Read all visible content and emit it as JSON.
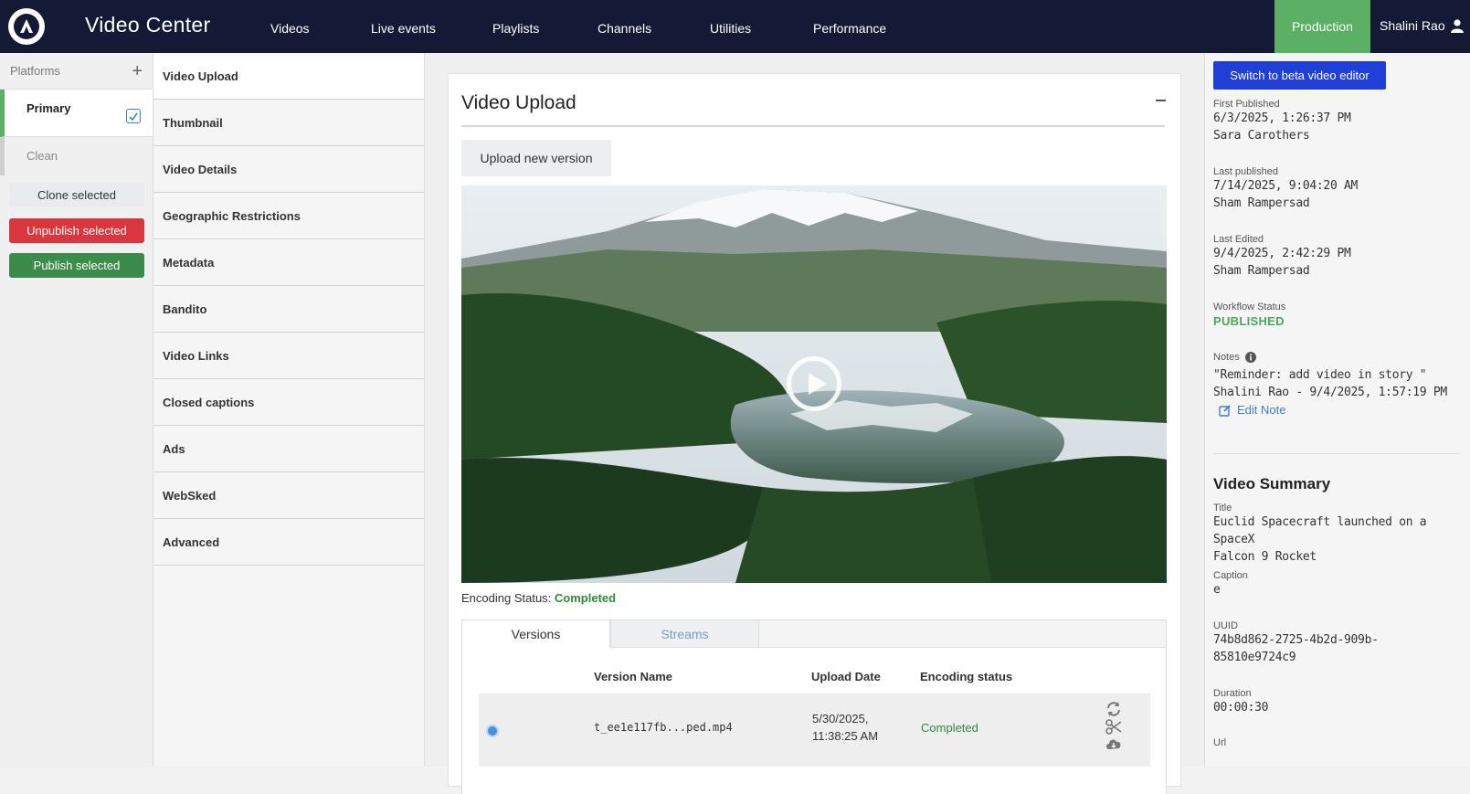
{
  "app": {
    "title": "Video Center"
  },
  "nav": [
    "Videos",
    "Live events",
    "Playlists",
    "Channels",
    "Utilities",
    "Performance"
  ],
  "header": {
    "environment": "Production",
    "user": "Shalini Rao"
  },
  "platforms": {
    "heading": "Platforms",
    "primary": "Primary",
    "clean": "Clean",
    "clone_label": "Clone selected",
    "unpublish_label": "Unpublish selected",
    "publish_label": "Publish selected"
  },
  "sections": [
    "Video Upload",
    "Thumbnail",
    "Video Details",
    "Geographic Restrictions",
    "Metadata",
    "Bandito",
    "Video Links",
    "Closed captions",
    "Ads",
    "WebSked",
    "Advanced"
  ],
  "upload": {
    "title": "Video Upload",
    "upload_label": "Upload new version",
    "encoding_label": "Encoding Status:",
    "encoding_value": "Completed",
    "tabs": [
      "Versions",
      "Streams"
    ],
    "columns": [
      "Version Name",
      "Upload Date",
      "Encoding status"
    ],
    "rows": [
      {
        "name": "t_ee1e117fb...ped.mp4",
        "date_line1": "5/30/2025,",
        "date_line2": "11:38:25 AM",
        "status": "Completed"
      }
    ]
  },
  "side": {
    "beta_label": "Switch to beta video editor",
    "first_published_label": "First Published",
    "first_published_date": "6/3/2025, 1:26:37 PM",
    "first_published_by": "Sara Carothers",
    "last_published_label": "Last published",
    "last_published_date": "7/14/2025, 9:04:20 AM",
    "last_published_by": "Sham Rampersad",
    "last_edited_label": "Last Edited",
    "last_edited_date": "9/4/2025, 2:42:29 PM",
    "last_edited_by": "Sham Rampersad",
    "workflow_label": "Workflow Status",
    "workflow_value": "PUBLISHED",
    "notes_label": "Notes",
    "note_text": "\"Reminder: add video in story \"",
    "note_author": "Shalini Rao - 9/4/2025, 1:57:19 PM",
    "edit_note_label": "Edit Note",
    "summary_title": "Video Summary",
    "title_label": "Title",
    "title_line1": "Euclid Spacecraft launched on a SpaceX",
    "title_line2": "Falcon 9 Rocket",
    "caption_label": "Caption",
    "caption_value": "e",
    "uuid_label": "UUID",
    "uuid_line1": "74b8d862-2725-4b2d-909b-",
    "uuid_line2": "85810e9724c9",
    "duration_label": "Duration",
    "duration_value": "00:00:30",
    "url_label": "Url"
  },
  "colors": {
    "topbar": "#141a36",
    "accent_green": "#5bb065",
    "danger": "#d9363e",
    "publish": "#3b8c4a",
    "beta": "#1f3fd6"
  }
}
